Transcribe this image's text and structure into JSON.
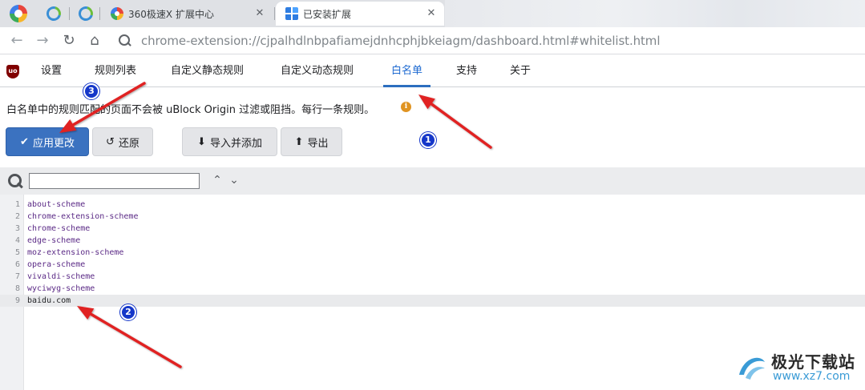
{
  "browser": {
    "tabs": [
      {
        "title": "360极速X 扩展中心",
        "close": "✕"
      },
      {
        "title": "已安装扩展",
        "close": "✕"
      }
    ],
    "url": "chrome-extension://cjpalhdlnbpafiamejdnhcphjbkeiagm/dashboard.html#whitelist.html",
    "nav": {
      "back": "←",
      "forward": "→",
      "reload": "↻",
      "home": "⌂"
    }
  },
  "ublock": {
    "logo_text": "uo",
    "tabs": [
      {
        "label": "设置"
      },
      {
        "label": "规则列表"
      },
      {
        "label": "自定义静态规则"
      },
      {
        "label": "自定义动态规则"
      },
      {
        "label": "白名单",
        "active": true
      },
      {
        "label": "支持"
      },
      {
        "label": "关于"
      }
    ],
    "notice": "白名单中的规则匹配的页面不会被 uBlock Origin 过滤或阻挡。每行一条规则。",
    "info_icon": "i",
    "buttons": {
      "apply": {
        "label": "应用更改",
        "icon": "✔"
      },
      "revert": {
        "label": "还原",
        "icon": "↺"
      },
      "import": {
        "label": "导入并添加",
        "icon": "⬇"
      },
      "export": {
        "label": "导出",
        "icon": "⬆"
      }
    },
    "find": {
      "value": "",
      "prev": "⌃",
      "next": "⌄"
    },
    "editor_lines": [
      {
        "n": "1",
        "text": "about-scheme"
      },
      {
        "n": "2",
        "text": "chrome-extension-scheme"
      },
      {
        "n": "3",
        "text": "chrome-scheme"
      },
      {
        "n": "4",
        "text": "edge-scheme"
      },
      {
        "n": "5",
        "text": "moz-extension-scheme"
      },
      {
        "n": "6",
        "text": "opera-scheme"
      },
      {
        "n": "7",
        "text": "vivaldi-scheme"
      },
      {
        "n": "8",
        "text": "wyciwyg-scheme"
      },
      {
        "n": "9",
        "text": "baidu.com"
      }
    ]
  },
  "annotations": {
    "badge1": "1",
    "badge2": "2",
    "badge3": "3",
    "arrow_color": "#e02020"
  },
  "watermark": {
    "name": "极光下载站",
    "domain": "www.xz7.com"
  }
}
